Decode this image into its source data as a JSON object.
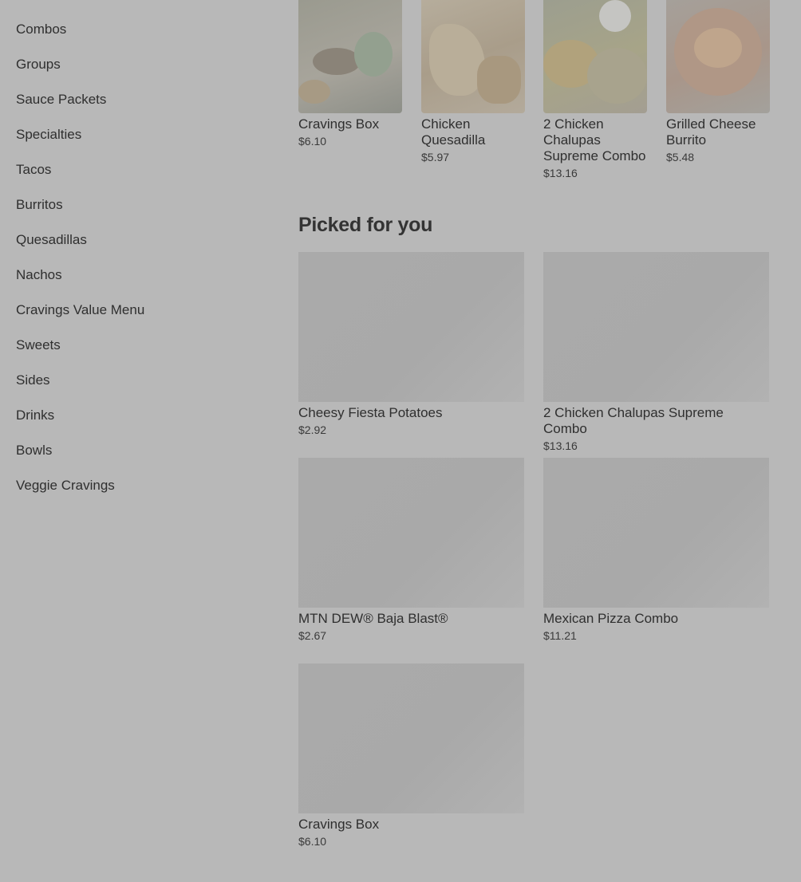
{
  "sidebar": {
    "items": [
      {
        "label": "Combos"
      },
      {
        "label": "Groups"
      },
      {
        "label": "Sauce Packets"
      },
      {
        "label": "Specialties"
      },
      {
        "label": "Tacos"
      },
      {
        "label": "Burritos"
      },
      {
        "label": "Quesadillas"
      },
      {
        "label": "Nachos"
      },
      {
        "label": "Cravings Value Menu"
      },
      {
        "label": "Sweets"
      },
      {
        "label": "Sides"
      },
      {
        "label": "Drinks"
      },
      {
        "label": "Bowls"
      },
      {
        "label": "Veggie Cravings"
      }
    ]
  },
  "top_items": [
    {
      "name": "Cravings Box",
      "price": "$6.10"
    },
    {
      "name": "Chicken Quesadilla",
      "price": "$5.97"
    },
    {
      "name": "2 Chicken Chalupas Supreme Combo",
      "price": "$13.16"
    },
    {
      "name": "Grilled Cheese Burrito",
      "price": "$5.48"
    }
  ],
  "picked": {
    "title": "Picked for you",
    "items": [
      {
        "name": "Cheesy Fiesta Potatoes",
        "price": "$2.92"
      },
      {
        "name": "2 Chicken Chalupas Supreme Combo",
        "price": "$13.16"
      },
      {
        "name": "MTN DEW® Baja Blast®",
        "price": "$2.67"
      },
      {
        "name": "Mexican Pizza Combo",
        "price": "$11.21"
      },
      {
        "name": "Cravings Box",
        "price": "$6.10"
      }
    ]
  },
  "colors": {
    "overlay_background": "#b8b8b8",
    "text": "#2f2f2f",
    "placeholder_image": "#aaaaaa"
  }
}
